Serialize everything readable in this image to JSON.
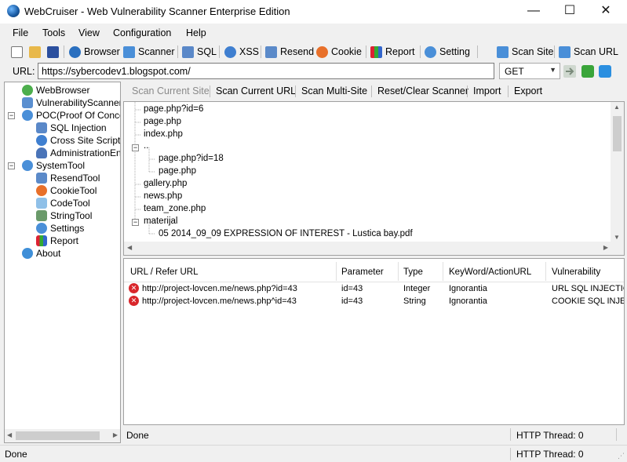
{
  "window": {
    "title": "WebCruiser - Web Vulnerability Scanner Enterprise Edition",
    "minimize": "—",
    "maximize": "☐",
    "close": "✕"
  },
  "menu": [
    "File",
    "Tools",
    "View",
    "Configuration",
    "Help"
  ],
  "toolbar": {
    "browser": "Browser",
    "scanner": "Scanner",
    "sql": "SQL",
    "xss": "XSS",
    "resend": "Resend",
    "cookie": "Cookie",
    "report": "Report",
    "setting": "Setting",
    "scan_site": "Scan Site",
    "scan_url": "Scan URL"
  },
  "urlbar": {
    "label": "URL:",
    "value": "https://sybercodev1.blogspot.com/",
    "method": "GET"
  },
  "nav_tree": {
    "web_browser": "WebBrowser",
    "vulnerability_scanner": "VulnerabilityScanner",
    "poc": "POC(Proof Of Concept)",
    "sql_injection": "SQL Injection",
    "cross_site_scripting": "Cross Site Scripting",
    "administration_entrance": "AdministrationEntrance",
    "system_tool": "SystemTool",
    "resend_tool": "ResendTool",
    "cookie_tool": "CookieTool",
    "code_tool": "CodeTool",
    "string_tool": "StringTool",
    "settings": "Settings",
    "report": "Report",
    "about": "About"
  },
  "scanner_toolbar": {
    "scan_current_site": "Scan Current Site",
    "scan_current_url": "Scan Current URL",
    "scan_multi_site": "Scan Multi-Site",
    "reset_clear": "Reset/Clear Scanner",
    "import": "Import",
    "export": "Export"
  },
  "site_tree": [
    "page.php?id=6",
    "page.php",
    "index.php",
    "..",
    "page.php?id=18",
    "page.php",
    "gallery.php",
    "news.php",
    "team_zone.php",
    "materijal",
    "05 2014_09_09 EXPRESSION OF INTEREST - Lustica bay.pdf"
  ],
  "results": {
    "columns": [
      "URL / Refer URL",
      "Parameter",
      "Type",
      "KeyWord/ActionURL",
      "Vulnerability"
    ],
    "rows": [
      [
        "http://project-lovcen.me/news.php?id=43",
        "id=43",
        "Integer",
        "Ignorantia",
        "URL SQL INJECTION"
      ],
      [
        "http://project-lovcen.me/news.php^id=43",
        "id=43",
        "String",
        "Ignorantia",
        "COOKIE SQL INJECTION"
      ]
    ]
  },
  "inner_status": {
    "state": "Done",
    "threads": "HTTP Thread: 0"
  },
  "status": {
    "state": "Done",
    "threads": "HTTP Thread: 0"
  }
}
